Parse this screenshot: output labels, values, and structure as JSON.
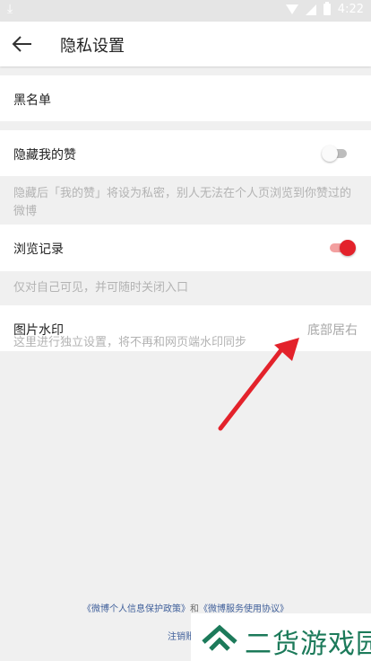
{
  "status_bar": {
    "time": "4:22"
  },
  "header": {
    "title": "隐私设置"
  },
  "settings": {
    "blacklist": {
      "label": "黑名单"
    },
    "hide_likes": {
      "label": "隐藏我的赞",
      "enabled": false,
      "hint": "隐藏后「我的赞」将设为私密，别人无法在个人页浏览到你赞过的微博"
    },
    "browsing_history": {
      "label": "浏览记录",
      "enabled": true,
      "hint": "仅对自己可见，并可随时关闭入口"
    },
    "image_watermark": {
      "label": "图片水印",
      "value": "底部居右",
      "hint": "这里进行独立设置，将不再和网页端水印同步"
    }
  },
  "footer": {
    "privacy_policy_link": "《微博个人信息保护政策》",
    "connector": "和",
    "service_agreement_link": "《微博服务使用协议》",
    "logout_partial": "注销账"
  },
  "watermark": {
    "text": "二货游戏园"
  },
  "colors": {
    "accent_red": "#e3222b",
    "toggle_on_track": "#f3a0a0",
    "toggle_off_knob": "#fafafa",
    "toggle_off_track": "#bdbdbd",
    "background": "#f0f0f0",
    "watermark_green": "#1c7a5a",
    "annotation_arrow": "#e3222b"
  },
  "icons": {
    "back": "arrow-left-icon",
    "download": "download-icon",
    "wifi": "wifi-icon",
    "signal": "signal-icon",
    "battery": "battery-icon"
  }
}
